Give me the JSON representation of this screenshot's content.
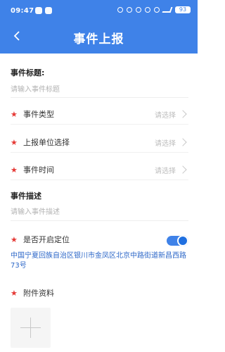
{
  "status_bar": {
    "time": "09:47",
    "battery": "93"
  },
  "header": {
    "title": "事件上报"
  },
  "form": {
    "event_title": {
      "label": "事件标题:",
      "placeholder": "请输入事件标题"
    },
    "event_type": {
      "label": "事件类型",
      "value": "请选择"
    },
    "report_unit": {
      "label": "上报单位选择",
      "value": "请选择"
    },
    "event_time": {
      "label": "事件时间",
      "value": "请选择"
    },
    "event_description": {
      "label": "事件描述",
      "placeholder": "请输入事件描述"
    },
    "location_toggle": {
      "label": "是否开启定位",
      "enabled": true
    },
    "address": "中国宁夏回族自治区银川市金凤区北京中路街道新昌西路73号",
    "attachments": {
      "label": "附件资料"
    }
  },
  "colors": {
    "header_bg": "#3f82e8",
    "required_star": "#e53935",
    "address_text": "#2c67c8"
  }
}
